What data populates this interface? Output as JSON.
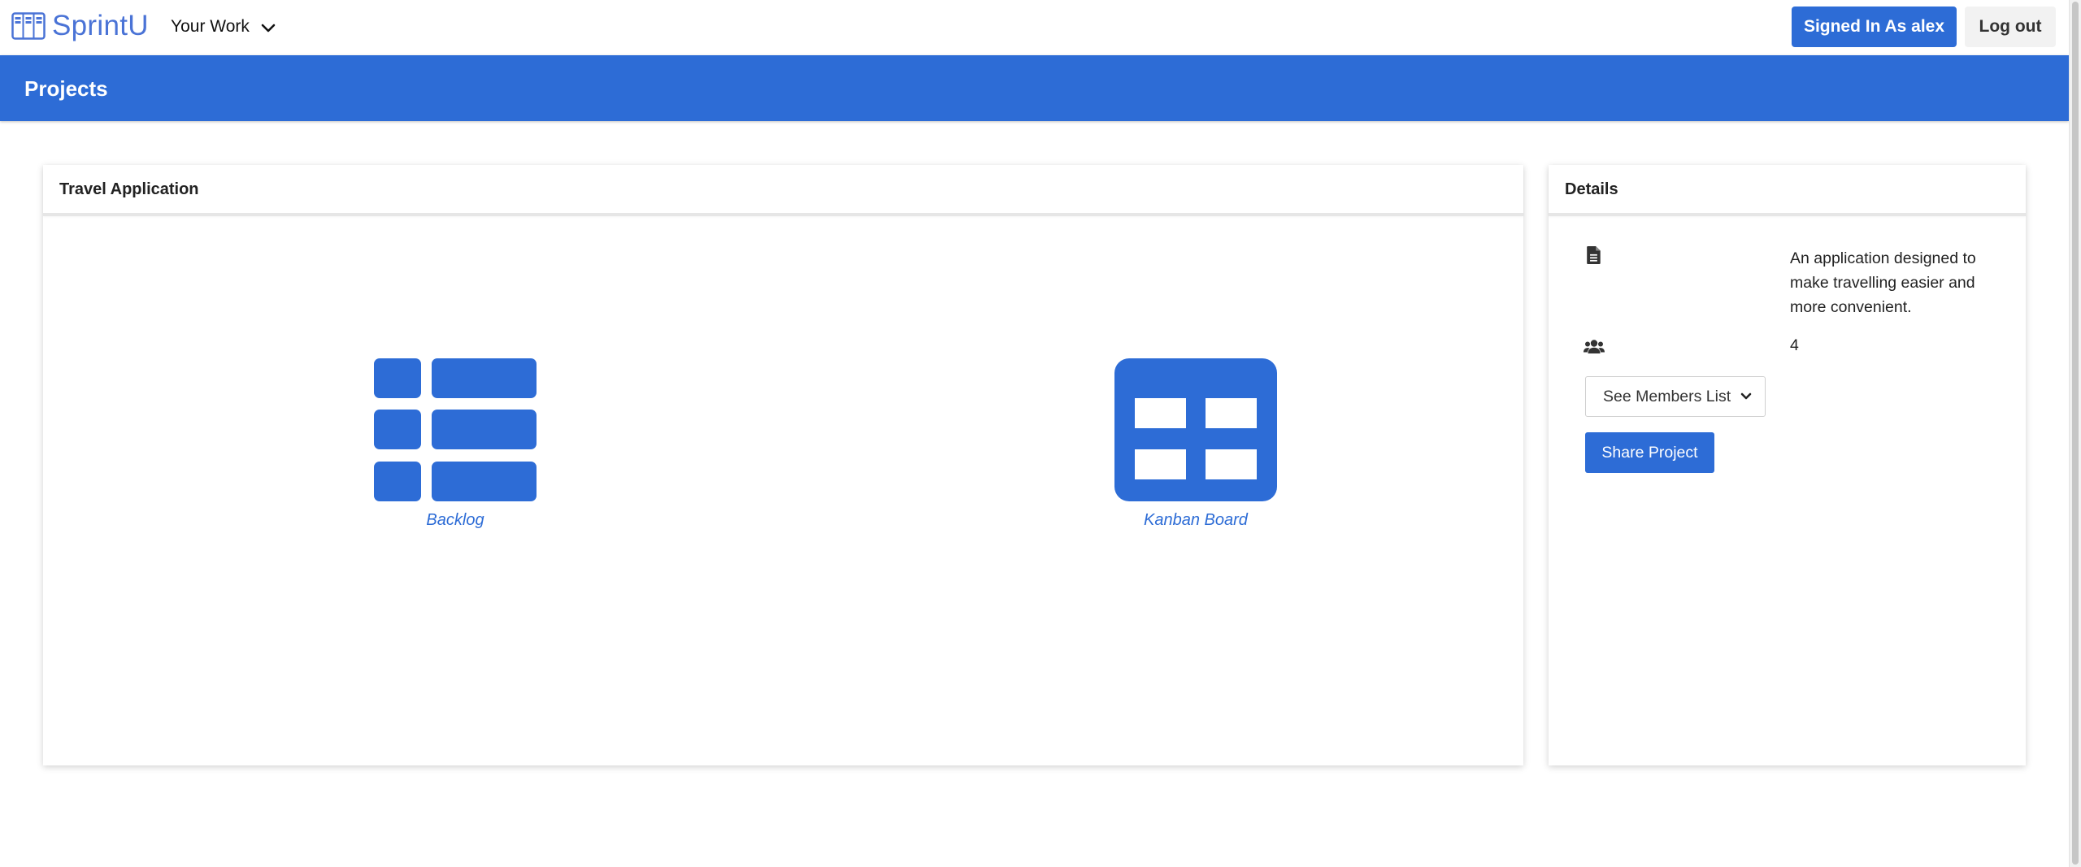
{
  "navbar": {
    "brand_name": "SprintU",
    "brand_icon": "kanban-board-logo-icon",
    "menu_label": "Your Work",
    "menu_icon": "chevron-down-icon",
    "signed_in_label": "Signed In As alex",
    "logout_label": "Log out"
  },
  "header": {
    "title": "Projects"
  },
  "project": {
    "name": "Travel Application",
    "tiles": [
      {
        "label": "Backlog",
        "icon": "backlog-list-icon"
      },
      {
        "label": "Kanban Board",
        "icon": "kanban-board-icon"
      }
    ]
  },
  "details": {
    "title": "Details",
    "description_icon": "document-icon",
    "description": "An application designed to make travelling easier and more convenient.",
    "members_icon": "users-icon",
    "member_count": "4",
    "members_select_label": "See Members List",
    "share_button_label": "Share Project"
  },
  "colors": {
    "primary": "#2d6cd6",
    "brand": "#4a73d6",
    "background": "#ffffff",
    "logout_bg": "#f2f2f2"
  }
}
